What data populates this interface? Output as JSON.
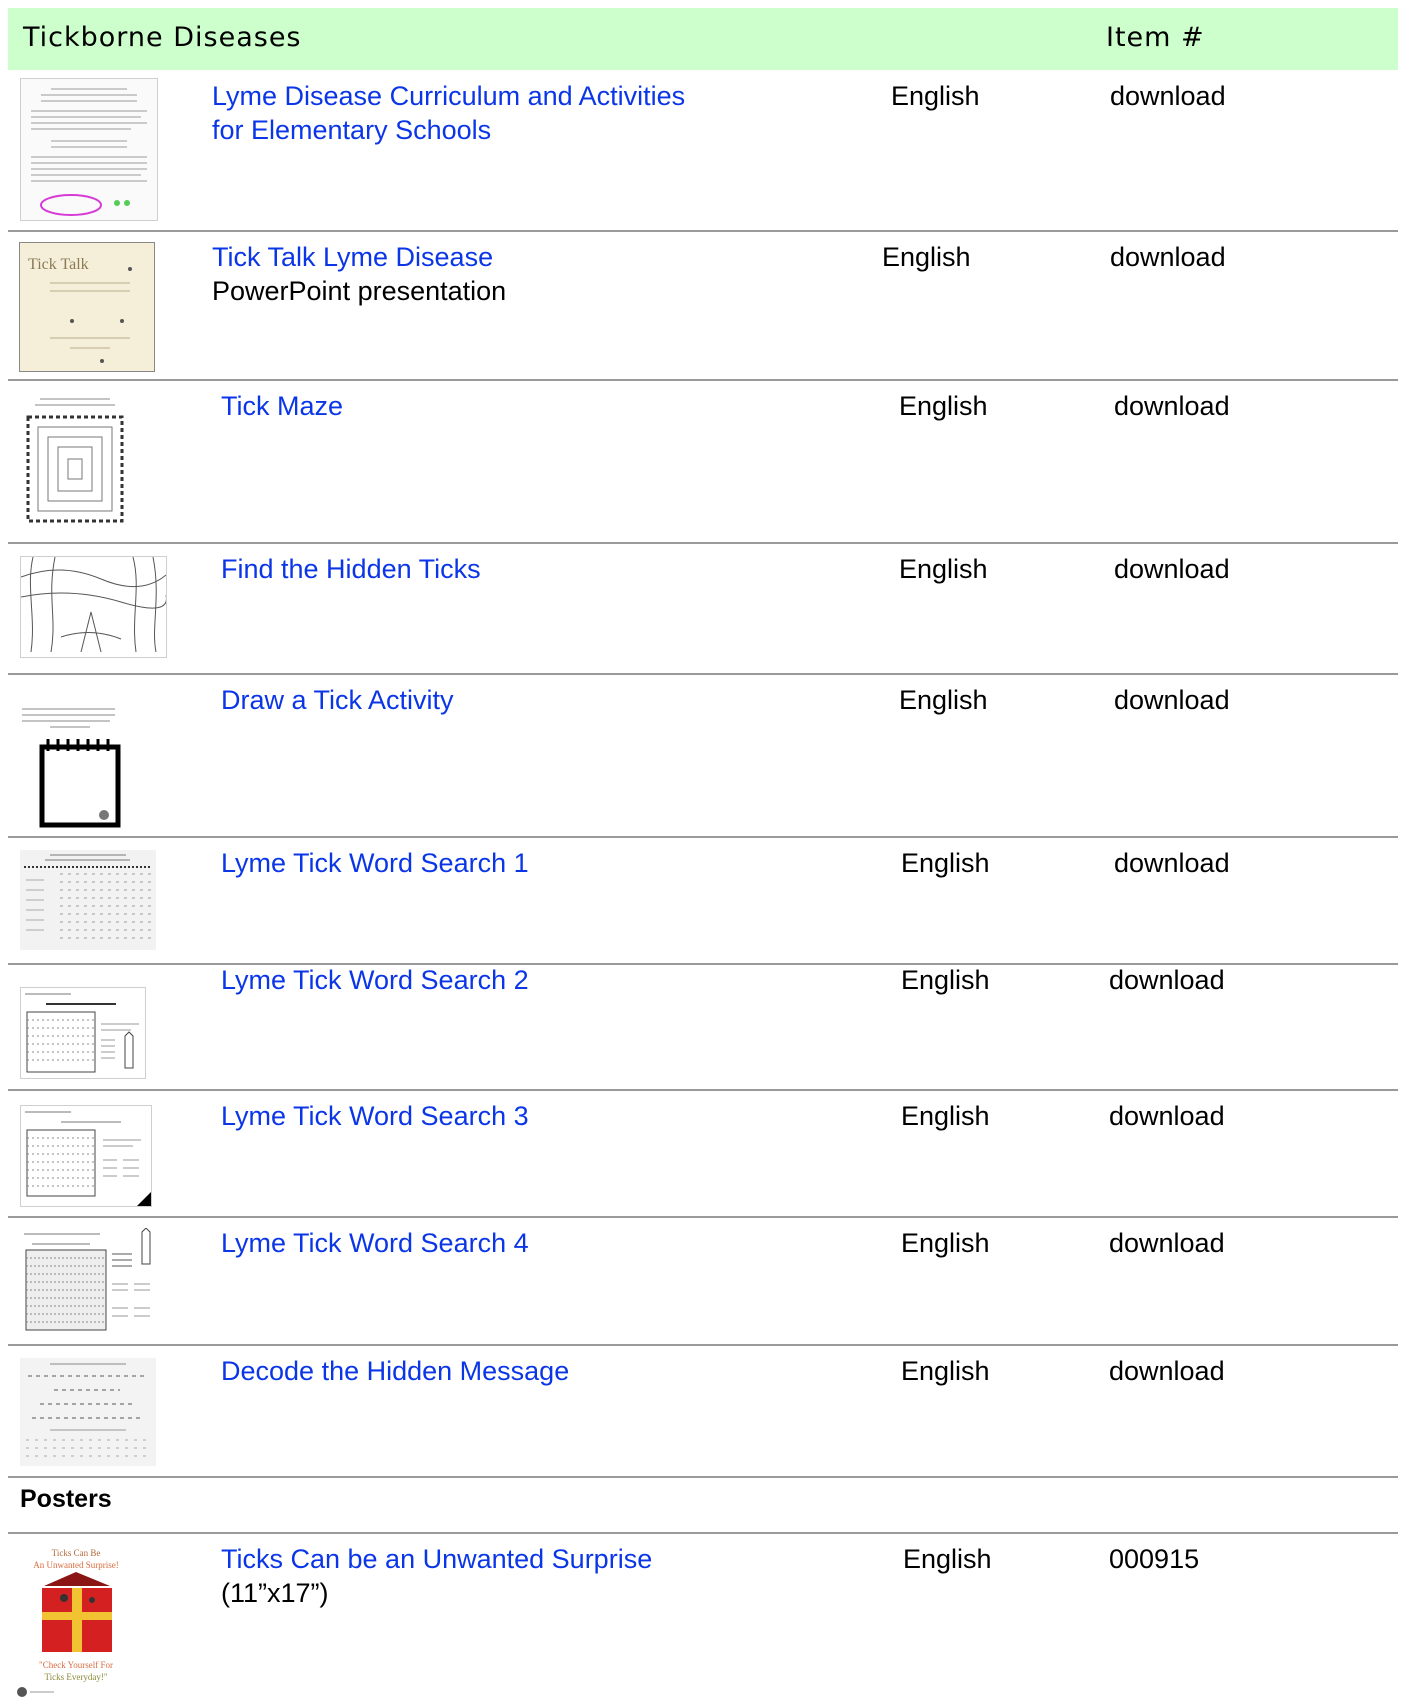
{
  "header": {
    "title": "Tickborne Diseases",
    "item_col": "Item #"
  },
  "rows": [
    {
      "title": "Lyme Disease Curriculum and Activities",
      "title2": "for Elementary Schools",
      "language": "English",
      "action": "download"
    },
    {
      "title": "Tick Talk Lyme Disease",
      "subtitle": "PowerPoint presentation",
      "language": "English",
      "action": "download"
    },
    {
      "title": "Tick Maze",
      "language": "English",
      "action": "download"
    },
    {
      "title": "Find the Hidden Ticks",
      "language": "English",
      "action": "download"
    },
    {
      "title": "Draw a Tick Activity",
      "language": "English",
      "action": "download"
    },
    {
      "title": "Lyme Tick Word Search 1",
      "language": "English",
      "action": "download"
    },
    {
      "title": "Lyme Tick Word Search 2",
      "language": "English",
      "action": "download"
    },
    {
      "title": "Lyme Tick Word Search 3",
      "language": "English",
      "action": "download"
    },
    {
      "title": "Lyme Tick Word Search 4",
      "language": "English",
      "action": "download"
    },
    {
      "title": "Decode the Hidden Message",
      "language": "English",
      "action": "download"
    }
  ],
  "posters": {
    "heading": "Posters",
    "items": [
      {
        "title": "Ticks Can be an Unwanted Surprise",
        "subtitle": "(11”x17”)",
        "language": "English",
        "item_number": "000915"
      }
    ]
  },
  "thumb_text": {
    "tick_talk": "Tick Talk",
    "poster_top": "Ticks Can Be",
    "poster_mid": "An Unwanted Surprise!",
    "poster_bottom": "\"Check Yourself For",
    "poster_bottom2": "Ticks Everyday!\""
  },
  "colors": {
    "header_bg": "#ccffcc",
    "link": "#0b36e8",
    "separator": "#9a9a9a"
  }
}
